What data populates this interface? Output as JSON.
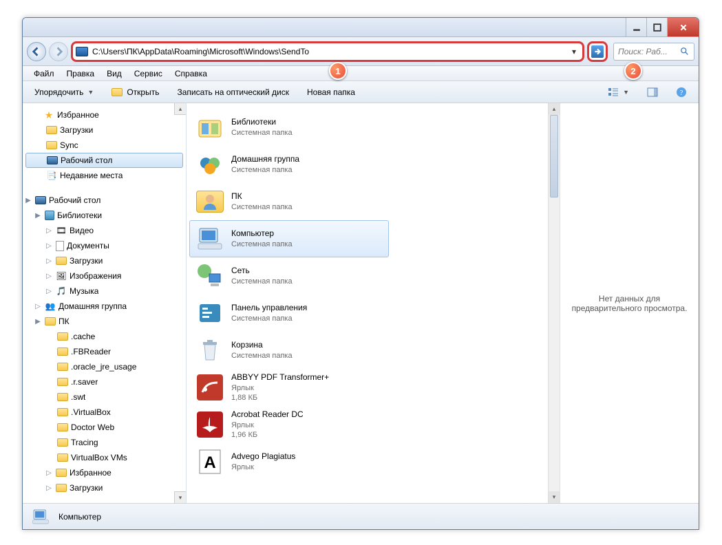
{
  "address": {
    "path": "C:\\Users\\ПК\\AppData\\Roaming\\Microsoft\\Windows\\SendTo"
  },
  "search": {
    "placeholder": "Поиск: Раб..."
  },
  "menu": {
    "file": "Файл",
    "edit": "Правка",
    "view": "Вид",
    "service": "Сервис",
    "help": "Справка"
  },
  "toolbar": {
    "organize": "Упорядочить",
    "open": "Открыть",
    "burn": "Записать на оптический диск",
    "newfolder": "Новая папка"
  },
  "callouts": {
    "one": "1",
    "two": "2"
  },
  "tree": {
    "favorites": "Избранное",
    "downloads": "Загрузки",
    "sync": "Sync",
    "desktop": "Рабочий стол",
    "recent": "Недавние места",
    "desktop2": "Рабочий стол",
    "libraries": "Библиотеки",
    "video": "Видео",
    "documents": "Документы",
    "dl2": "Загрузки",
    "images": "Изображения",
    "music": "Музыка",
    "homegroup": "Домашняя группа",
    "pk": "ПК",
    "cache": ".cache",
    "fb": ".FBReader",
    "oracle": ".oracle_jre_usage",
    "rsaver": ".r.saver",
    "swt": ".swt",
    "vbox": ".VirtualBox",
    "drweb": "Doctor Web",
    "tracing": "Tracing",
    "vboxvms": "VirtualBox VMs",
    "favorites2": "Избранное",
    "dl3": "Загрузки"
  },
  "items": [
    {
      "name": "Библиотеки",
      "sub1": "Системная папка",
      "sub2": ""
    },
    {
      "name": "Домашняя группа",
      "sub1": "Системная папка",
      "sub2": ""
    },
    {
      "name": "ПК",
      "sub1": "Системная папка",
      "sub2": ""
    },
    {
      "name": "Компьютер",
      "sub1": "Системная папка",
      "sub2": ""
    },
    {
      "name": "Сеть",
      "sub1": "Системная папка",
      "sub2": ""
    },
    {
      "name": "Панель управления",
      "sub1": "Системная папка",
      "sub2": ""
    },
    {
      "name": "Корзина",
      "sub1": "Системная папка",
      "sub2": ""
    },
    {
      "name": "ABBYY PDF Transformer+",
      "sub1": "Ярлык",
      "sub2": "1,88 КБ"
    },
    {
      "name": "Acrobat Reader DC",
      "sub1": "Ярлык",
      "sub2": "1,96 КБ"
    },
    {
      "name": "Advego Plagiatus",
      "sub1": "Ярлык",
      "sub2": ""
    }
  ],
  "preview": {
    "text": "Нет данных для предварительного просмотра."
  },
  "status": {
    "label": "Компьютер"
  }
}
